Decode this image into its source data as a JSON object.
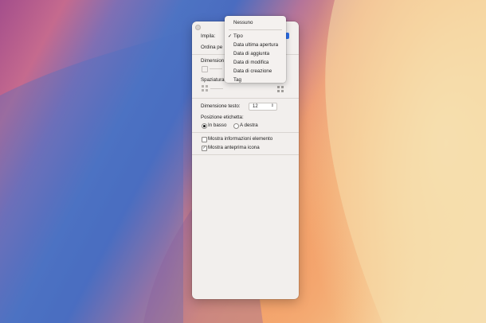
{
  "settings": {
    "impila_label": "Impila:",
    "ordina_label": "Ordina pe",
    "dimensione_icone_label": "Dimension",
    "spaziatura_label": "Spaziatura",
    "dimensione_testo_label": "Dimensione testo:",
    "dimensione_testo_value": "12",
    "posizione_etichetta_label": "Posizione etichetta:",
    "radio_in_basso": "In basso",
    "radio_a_destra": "A destra",
    "radio_selected": "In basso",
    "check_info_label": "Mostra informazioni elemento",
    "check_info_checked": false,
    "check_anteprima_label": "Mostra anteprima icona",
    "check_anteprima_checked": true
  },
  "menu": {
    "items": [
      {
        "label": "Nessuno",
        "checked": false
      },
      {
        "label": "Tipo",
        "checked": true
      },
      {
        "label": "Data ultima apertura",
        "checked": false
      },
      {
        "label": "Data di aggiunta",
        "checked": false
      },
      {
        "label": "Data di modifica",
        "checked": false
      },
      {
        "label": "Data di creazione",
        "checked": false
      },
      {
        "label": "Tag",
        "checked": false
      }
    ],
    "checkmark": "✓"
  },
  "colors": {
    "accent": "#2c6ee8",
    "window_bg": "#f2efed"
  }
}
